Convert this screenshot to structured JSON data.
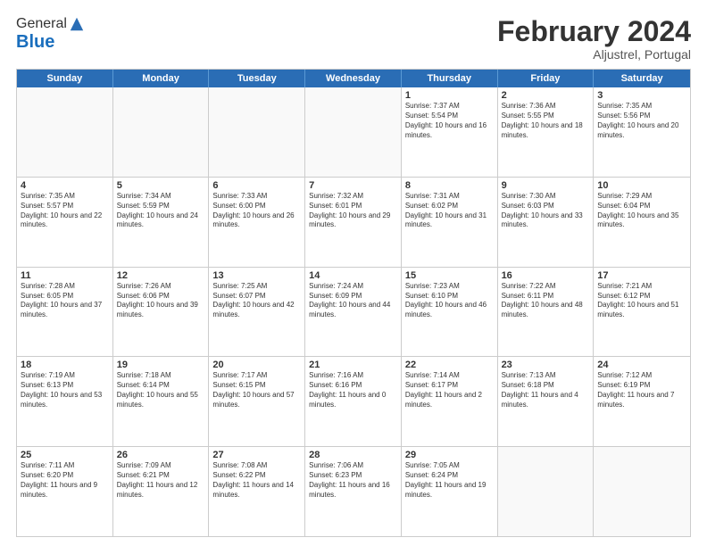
{
  "header": {
    "logo_general": "General",
    "logo_blue": "Blue",
    "main_title": "February 2024",
    "subtitle": "Aljustrel, Portugal"
  },
  "calendar": {
    "days": [
      "Sunday",
      "Monday",
      "Tuesday",
      "Wednesday",
      "Thursday",
      "Friday",
      "Saturday"
    ],
    "rows": [
      [
        {
          "day": "",
          "empty": true
        },
        {
          "day": "",
          "empty": true
        },
        {
          "day": "",
          "empty": true
        },
        {
          "day": "",
          "empty": true
        },
        {
          "day": "1",
          "sunrise": "Sunrise: 7:37 AM",
          "sunset": "Sunset: 5:54 PM",
          "daylight": "Daylight: 10 hours and 16 minutes."
        },
        {
          "day": "2",
          "sunrise": "Sunrise: 7:36 AM",
          "sunset": "Sunset: 5:55 PM",
          "daylight": "Daylight: 10 hours and 18 minutes."
        },
        {
          "day": "3",
          "sunrise": "Sunrise: 7:35 AM",
          "sunset": "Sunset: 5:56 PM",
          "daylight": "Daylight: 10 hours and 20 minutes."
        }
      ],
      [
        {
          "day": "4",
          "sunrise": "Sunrise: 7:35 AM",
          "sunset": "Sunset: 5:57 PM",
          "daylight": "Daylight: 10 hours and 22 minutes."
        },
        {
          "day": "5",
          "sunrise": "Sunrise: 7:34 AM",
          "sunset": "Sunset: 5:59 PM",
          "daylight": "Daylight: 10 hours and 24 minutes."
        },
        {
          "day": "6",
          "sunrise": "Sunrise: 7:33 AM",
          "sunset": "Sunset: 6:00 PM",
          "daylight": "Daylight: 10 hours and 26 minutes."
        },
        {
          "day": "7",
          "sunrise": "Sunrise: 7:32 AM",
          "sunset": "Sunset: 6:01 PM",
          "daylight": "Daylight: 10 hours and 29 minutes."
        },
        {
          "day": "8",
          "sunrise": "Sunrise: 7:31 AM",
          "sunset": "Sunset: 6:02 PM",
          "daylight": "Daylight: 10 hours and 31 minutes."
        },
        {
          "day": "9",
          "sunrise": "Sunrise: 7:30 AM",
          "sunset": "Sunset: 6:03 PM",
          "daylight": "Daylight: 10 hours and 33 minutes."
        },
        {
          "day": "10",
          "sunrise": "Sunrise: 7:29 AM",
          "sunset": "Sunset: 6:04 PM",
          "daylight": "Daylight: 10 hours and 35 minutes."
        }
      ],
      [
        {
          "day": "11",
          "sunrise": "Sunrise: 7:28 AM",
          "sunset": "Sunset: 6:05 PM",
          "daylight": "Daylight: 10 hours and 37 minutes."
        },
        {
          "day": "12",
          "sunrise": "Sunrise: 7:26 AM",
          "sunset": "Sunset: 6:06 PM",
          "daylight": "Daylight: 10 hours and 39 minutes."
        },
        {
          "day": "13",
          "sunrise": "Sunrise: 7:25 AM",
          "sunset": "Sunset: 6:07 PM",
          "daylight": "Daylight: 10 hours and 42 minutes."
        },
        {
          "day": "14",
          "sunrise": "Sunrise: 7:24 AM",
          "sunset": "Sunset: 6:09 PM",
          "daylight": "Daylight: 10 hours and 44 minutes."
        },
        {
          "day": "15",
          "sunrise": "Sunrise: 7:23 AM",
          "sunset": "Sunset: 6:10 PM",
          "daylight": "Daylight: 10 hours and 46 minutes."
        },
        {
          "day": "16",
          "sunrise": "Sunrise: 7:22 AM",
          "sunset": "Sunset: 6:11 PM",
          "daylight": "Daylight: 10 hours and 48 minutes."
        },
        {
          "day": "17",
          "sunrise": "Sunrise: 7:21 AM",
          "sunset": "Sunset: 6:12 PM",
          "daylight": "Daylight: 10 hours and 51 minutes."
        }
      ],
      [
        {
          "day": "18",
          "sunrise": "Sunrise: 7:19 AM",
          "sunset": "Sunset: 6:13 PM",
          "daylight": "Daylight: 10 hours and 53 minutes."
        },
        {
          "day": "19",
          "sunrise": "Sunrise: 7:18 AM",
          "sunset": "Sunset: 6:14 PM",
          "daylight": "Daylight: 10 hours and 55 minutes."
        },
        {
          "day": "20",
          "sunrise": "Sunrise: 7:17 AM",
          "sunset": "Sunset: 6:15 PM",
          "daylight": "Daylight: 10 hours and 57 minutes."
        },
        {
          "day": "21",
          "sunrise": "Sunrise: 7:16 AM",
          "sunset": "Sunset: 6:16 PM",
          "daylight": "Daylight: 11 hours and 0 minutes."
        },
        {
          "day": "22",
          "sunrise": "Sunrise: 7:14 AM",
          "sunset": "Sunset: 6:17 PM",
          "daylight": "Daylight: 11 hours and 2 minutes."
        },
        {
          "day": "23",
          "sunrise": "Sunrise: 7:13 AM",
          "sunset": "Sunset: 6:18 PM",
          "daylight": "Daylight: 11 hours and 4 minutes."
        },
        {
          "day": "24",
          "sunrise": "Sunrise: 7:12 AM",
          "sunset": "Sunset: 6:19 PM",
          "daylight": "Daylight: 11 hours and 7 minutes."
        }
      ],
      [
        {
          "day": "25",
          "sunrise": "Sunrise: 7:11 AM",
          "sunset": "Sunset: 6:20 PM",
          "daylight": "Daylight: 11 hours and 9 minutes."
        },
        {
          "day": "26",
          "sunrise": "Sunrise: 7:09 AM",
          "sunset": "Sunset: 6:21 PM",
          "daylight": "Daylight: 11 hours and 12 minutes."
        },
        {
          "day": "27",
          "sunrise": "Sunrise: 7:08 AM",
          "sunset": "Sunset: 6:22 PM",
          "daylight": "Daylight: 11 hours and 14 minutes."
        },
        {
          "day": "28",
          "sunrise": "Sunrise: 7:06 AM",
          "sunset": "Sunset: 6:23 PM",
          "daylight": "Daylight: 11 hours and 16 minutes."
        },
        {
          "day": "29",
          "sunrise": "Sunrise: 7:05 AM",
          "sunset": "Sunset: 6:24 PM",
          "daylight": "Daylight: 11 hours and 19 minutes."
        },
        {
          "day": "",
          "empty": true
        },
        {
          "day": "",
          "empty": true
        }
      ]
    ]
  }
}
